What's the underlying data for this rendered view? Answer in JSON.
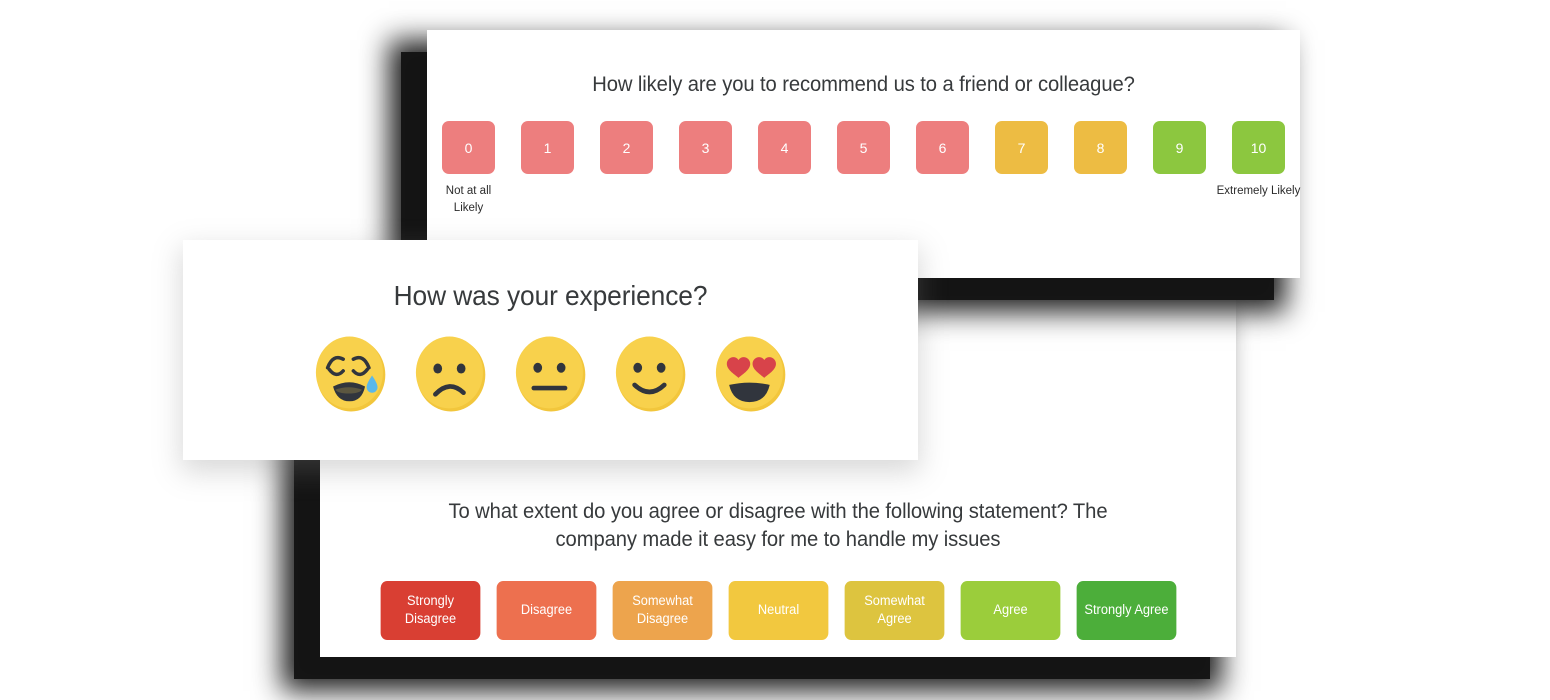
{
  "cards": {
    "nps": {
      "name": "nps-question-card",
      "question": "How likely are you to recommend us to a friend or colleague?",
      "left_caption": "Not at all Likely",
      "right_caption": "Extremely Likely",
      "scale": [
        {
          "label": "0",
          "color": "#ed7e7e"
        },
        {
          "label": "1",
          "color": "#ed7e7e"
        },
        {
          "label": "2",
          "color": "#ed7e7e"
        },
        {
          "label": "3",
          "color": "#ed7e7e"
        },
        {
          "label": "4",
          "color": "#ed7e7e"
        },
        {
          "label": "5",
          "color": "#ed7e7e"
        },
        {
          "label": "6",
          "color": "#ed7e7e"
        },
        {
          "label": "7",
          "color": "#edbc43"
        },
        {
          "label": "8",
          "color": "#edbc43"
        },
        {
          "label": "9",
          "color": "#8cc73f"
        },
        {
          "label": "10",
          "color": "#8cc73f"
        }
      ]
    },
    "csat": {
      "name": "csat-question-card",
      "question": "How was your experience?",
      "options": [
        {
          "icon": "crying-face-emoji",
          "label": "Crying face"
        },
        {
          "icon": "frowning-face-emoji",
          "label": "Frowning face"
        },
        {
          "icon": "neutral-face-emoji",
          "label": "Neutral face"
        },
        {
          "icon": "slightly-smiling-emoji",
          "label": "Slightly smiling face"
        },
        {
          "icon": "heart-eyes-emoji",
          "label": "Smiling face with heart eyes"
        }
      ],
      "face_color": "#f8d14c",
      "face_shade": "#f2c63c",
      "feature_color": "#31353d",
      "tear_color": "#5bb8ea",
      "heart_color": "#d8434a"
    },
    "ces": {
      "name": "ces-question-card",
      "question": "To what extent do you agree or disagree with the following statement? The company made it easy for me to handle my issues",
      "scale": [
        {
          "label": "Strongly Disagree",
          "color": "#d93f33"
        },
        {
          "label": "Disagree",
          "color": "#ed704f"
        },
        {
          "label": "Somewhat Disagree",
          "color": "#eda44d"
        },
        {
          "label": "Neutral",
          "color": "#f2c83f"
        },
        {
          "label": "Somewhat Agree",
          "color": "#ddc43f"
        },
        {
          "label": "Agree",
          "color": "#9bcd3b"
        },
        {
          "label": "Strongly Agree",
          "color": "#4cae3a"
        }
      ]
    }
  }
}
